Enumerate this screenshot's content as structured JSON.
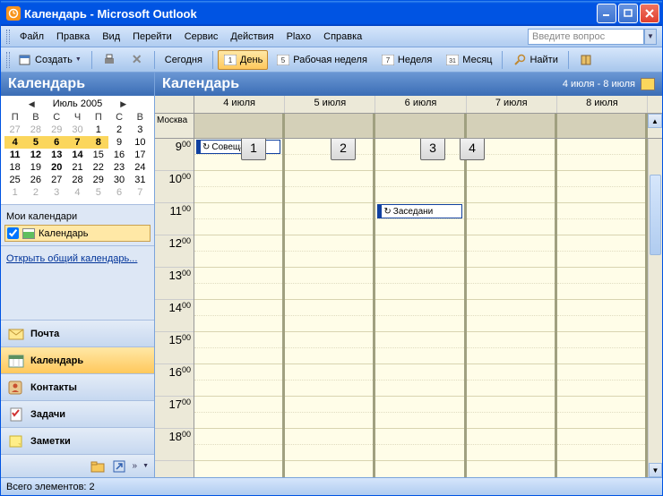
{
  "window": {
    "title": "Календарь - Microsoft Outlook"
  },
  "menu": {
    "file": "Файл",
    "edit": "Правка",
    "view": "Вид",
    "go": "Перейти",
    "service": "Сервис",
    "actions": "Действия",
    "plaxo": "Plaxo",
    "help": "Справка",
    "question_placeholder": "Введите вопрос"
  },
  "toolbar": {
    "create": "Создать",
    "today": "Сегодня",
    "day": "День",
    "workweek": "Рабочая неделя",
    "week": "Неделя",
    "month": "Месяц",
    "find": "Найти"
  },
  "left": {
    "title": "Календарь",
    "month_year": "Июль 2005",
    "dow": [
      "П",
      "В",
      "С",
      "Ч",
      "П",
      "С",
      "В"
    ],
    "weeks": [
      {
        "days": [
          27,
          28,
          29,
          30,
          1,
          2,
          3
        ],
        "gray": [
          0,
          1,
          2,
          3
        ],
        "bold": []
      },
      {
        "days": [
          4,
          5,
          6,
          7,
          8,
          9,
          10
        ],
        "gray": [],
        "bold": [
          0,
          1,
          2,
          3,
          4
        ],
        "hl": [
          0,
          1,
          2,
          3,
          4
        ]
      },
      {
        "days": [
          11,
          12,
          13,
          14,
          15,
          16,
          17
        ],
        "gray": [],
        "bold": [
          0,
          1,
          2,
          3
        ]
      },
      {
        "days": [
          18,
          19,
          20,
          21,
          22,
          23,
          24
        ],
        "gray": [],
        "bold": [
          2
        ]
      },
      {
        "days": [
          25,
          26,
          27,
          28,
          29,
          30,
          31
        ],
        "gray": [],
        "bold": []
      },
      {
        "days": [
          1,
          2,
          3,
          4,
          5,
          6,
          7
        ],
        "gray": [
          0,
          1,
          2,
          3,
          4,
          5,
          6
        ],
        "bold": []
      }
    ],
    "my_calendars": "Мои календари",
    "calendar_item": "Календарь",
    "share_link": "Открыть общий календарь...",
    "nav": {
      "mail": "Почта",
      "calendar": "Календарь",
      "contacts": "Контакты",
      "tasks": "Задачи",
      "notes": "Заметки"
    }
  },
  "calendar": {
    "title": "Календарь",
    "range": "4 июля - 8 июля",
    "days": [
      "4 июля",
      "5 июля",
      "6 июля",
      "7 июля",
      "8 июля"
    ],
    "allday_label": "Москва",
    "hours": [
      "9",
      "10",
      "11",
      "12",
      "13",
      "14",
      "15",
      "16",
      "17",
      "18"
    ],
    "minute": "00",
    "appts": [
      {
        "day": 0,
        "slot": 0,
        "text": "Совещание"
      },
      {
        "day": 2,
        "slot": 4,
        "text": "Заседани"
      }
    ]
  },
  "callouts": [
    "1",
    "2",
    "3",
    "4"
  ],
  "status": "Всего элементов: 2"
}
